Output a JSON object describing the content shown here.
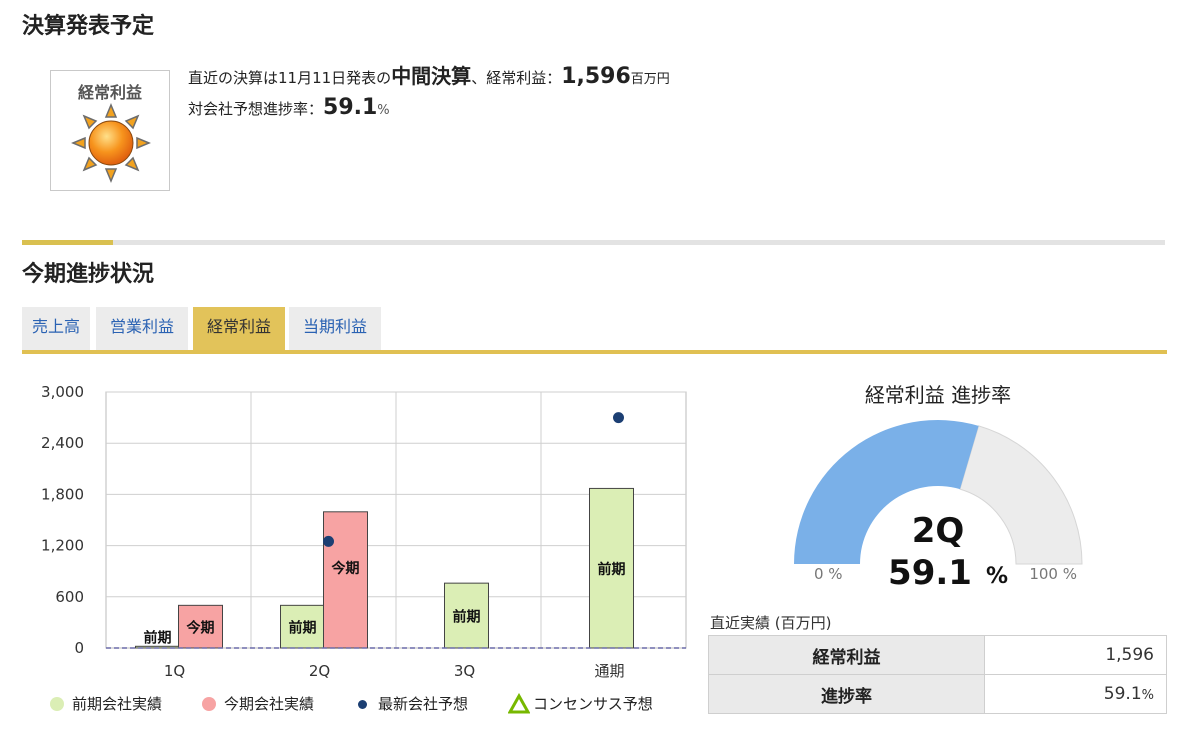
{
  "section1": {
    "title": "決算発表予定",
    "badge_label": "経常利益",
    "badge_icon": "sun-weather-icon",
    "line1_prefix": "直近の決算は11月11日発表の",
    "line1_type": "中間決算",
    "line1_mid": "、経常利益：",
    "line1_value": "1,596",
    "line1_unit": "百万円",
    "line2_prefix": "対会社予想進捗率：",
    "line2_value": "59.1",
    "line2_unit": "%"
  },
  "section2": {
    "title": "今期進捗状況",
    "tabs": [
      {
        "label": "売上高"
      },
      {
        "label": "営業利益"
      },
      {
        "label": "経常利益"
      },
      {
        "label": "当期利益"
      }
    ],
    "active_tab": 2
  },
  "chart_data": {
    "type": "bar",
    "categories": [
      "1Q",
      "2Q",
      "3Q",
      "通期"
    ],
    "ylim": [
      0,
      3000
    ],
    "yticks": [
      0,
      600,
      1200,
      1800,
      2400,
      3000
    ],
    "ytick_labels": [
      "0",
      "600",
      "1,200",
      "1,800",
      "2,400",
      "3,000"
    ],
    "bar_label_prev": "前期",
    "bar_label_curr": "今期",
    "series": [
      {
        "name": "前期会社実績",
        "color": "#dbeeb5",
        "values": [
          20,
          500,
          760,
          1870
        ]
      },
      {
        "name": "今期会社実績",
        "color": "#f7a3a3",
        "values": [
          500,
          1596,
          null,
          null
        ]
      },
      {
        "name": "最新会社予想",
        "color": "#1c3f73",
        "values": [
          null,
          1250,
          null,
          2700
        ]
      },
      {
        "name": "コンセンサス予想",
        "color": "#77b800",
        "values": [
          null,
          null,
          null,
          null
        ]
      }
    ],
    "grid": true,
    "legend_position": "bottom"
  },
  "gauge": {
    "title": "経常利益 進捗率",
    "quarter": "2Q",
    "value": 59.1,
    "value_text": "59.1",
    "unit": "%",
    "min_label": "0 %",
    "max_label": "100 %",
    "fill_color": "#7ab0e8",
    "track_color": "#ececec"
  },
  "recent": {
    "title": "直近実績 (百万円)",
    "rows": [
      {
        "label": "経常利益",
        "value": "1,596",
        "unit": ""
      },
      {
        "label": "進捗率",
        "value": "59.1",
        "unit": "%"
      }
    ]
  }
}
